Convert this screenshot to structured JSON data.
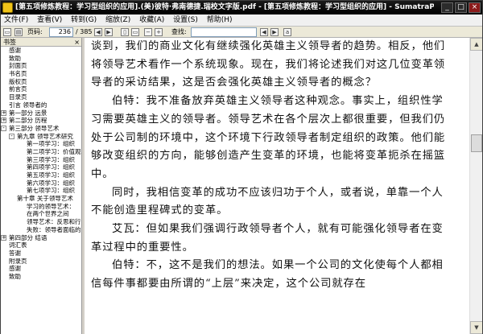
{
  "window": {
    "title": "[第五项修炼教程：学习型组织的应用].(美)彼特·弗南德捷.瑞校文字版.pdf - [第五项修炼教程：学习型组织的应用] - SumatraPDF",
    "minimize": "_",
    "maximize": "□",
    "close": "×"
  },
  "menu": {
    "items": [
      "文件(F)",
      "查看(V)",
      "转到(G)",
      "缩放(Z)",
      "收藏(A)",
      "设置(S)",
      "帮助(H)"
    ]
  },
  "toolbar": {
    "page_label": "页码:",
    "page_value": "236",
    "page_total": "/ 385",
    "search_label": "查找:"
  },
  "sidebar": {
    "title": "书签",
    "close": "×",
    "items": [
      {
        "label": "感谢",
        "level": 1
      },
      {
        "label": "致助",
        "level": 1
      },
      {
        "label": "封面页",
        "level": 1
      },
      {
        "label": "书名页",
        "level": 1
      },
      {
        "label": "版权页",
        "level": 1
      },
      {
        "label": "前言页",
        "level": 1
      },
      {
        "label": "目录页",
        "level": 1
      },
      {
        "label": "引言 领导者的",
        "level": 1
      },
      {
        "label": "第一部分 远景",
        "level": 1,
        "expand": "+"
      },
      {
        "label": "第二部分 历程",
        "level": 1,
        "expand": "+"
      },
      {
        "label": "第三部分 领导艺术",
        "level": 1,
        "expand": "-"
      },
      {
        "label": "第九章 领导艺术研究",
        "level": 2,
        "expand": "-"
      },
      {
        "label": "第一项学习：组织",
        "level": 3
      },
      {
        "label": "第二项学习：价值观",
        "level": 3
      },
      {
        "label": "第三项学习：组织",
        "level": 3
      },
      {
        "label": "第四项学习：组织",
        "level": 3
      },
      {
        "label": "第五项学习：组织",
        "level": 3
      },
      {
        "label": "第六项学习：组织",
        "level": 3
      },
      {
        "label": "第七项学习：组织",
        "level": 3
      },
      {
        "label": "第十章 关于领导艺术",
        "level": 2
      },
      {
        "label": "学习的领导艺术：",
        "level": 3
      },
      {
        "label": "在两个世界之间",
        "level": 3
      },
      {
        "label": "领导艺术：反思和行",
        "level": 3
      },
      {
        "label": "失败：领导者面临的",
        "level": 3
      },
      {
        "label": "第四部分 结语",
        "level": 1,
        "expand": "+"
      },
      {
        "label": "词汇表",
        "level": 1
      },
      {
        "label": "答谢",
        "level": 1
      },
      {
        "label": "附录页",
        "level": 1
      },
      {
        "label": "感谢",
        "level": 1
      },
      {
        "label": "致助",
        "level": 1
      }
    ]
  },
  "document": {
    "paragraphs": [
      {
        "indent": false,
        "text": "谈到，我们的商业文化有继续强化英雄主义领导者的趋势。相反，他们将领导艺术看作一个系统现象。现在，我们将论述我们对这几位变革领导者的采访结果，这是否会强化英雄主义领导者的概念？"
      },
      {
        "indent": true,
        "text": "伯特：我不准备放弃英雄主义领导者这种观念。事实上，组织性学习需要英雄主义的领导者。领导艺术在各个层次上都很重要，但我们仍处于公司制的环境中，这个环境下行政领导者制定组织的政策。他们能够改变组织的方向，能够创造产生变革的环境，也能将变革扼杀在摇篮中。"
      },
      {
        "indent": true,
        "text": "同时，我相信变革的成功不应该归功于个人，或者说，单靠一个人不能创造里程碑式的变革。"
      },
      {
        "indent": true,
        "text": "艾瓦：但如果我们强调行政领导者个人，就有可能强化领导者在变革过程中的重要性。"
      },
      {
        "indent": true,
        "text": "伯特：不，这不是我们的想法。如果一个公司的文化使每个人都相信每件事都要由所谓的“上层”来决定，这个公司就存在"
      }
    ]
  }
}
